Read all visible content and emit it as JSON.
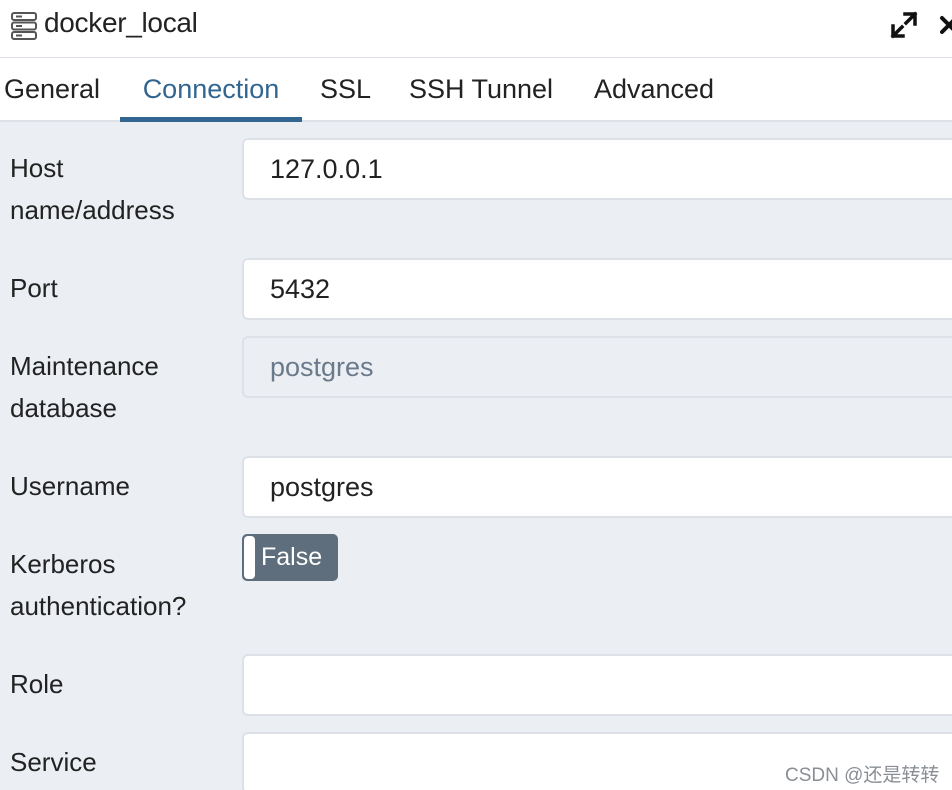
{
  "dialog": {
    "title": "docker_local",
    "icons": {
      "server": "server-icon",
      "expand": "expand-icon",
      "close": "close-icon"
    }
  },
  "tabs": [
    {
      "label": "General",
      "active": false
    },
    {
      "label": "Connection",
      "active": true
    },
    {
      "label": "SSL",
      "active": false
    },
    {
      "label": "SSH Tunnel",
      "active": false
    },
    {
      "label": "Advanced",
      "active": false
    }
  ],
  "form": {
    "host": {
      "label_line1": "Host",
      "label_line2": "name/address",
      "value": "127.0.0.1"
    },
    "port": {
      "label": "Port",
      "value": "5432"
    },
    "maintenance_db": {
      "label_line1": "Maintenance",
      "label_line2": "database",
      "value": "postgres",
      "disabled": true
    },
    "username": {
      "label": "Username",
      "value": "postgres"
    },
    "kerberos": {
      "label_line1": "Kerberos",
      "label_line2": "authentication?",
      "toggle_text": "False",
      "value": false
    },
    "role": {
      "label": "Role",
      "value": ""
    },
    "service": {
      "label": "Service",
      "value": ""
    }
  },
  "watermark": "CSDN @还是转转",
  "colors": {
    "accent": "#326690",
    "background": "#ebeef3",
    "toggle_off": "#5f6e7c"
  }
}
